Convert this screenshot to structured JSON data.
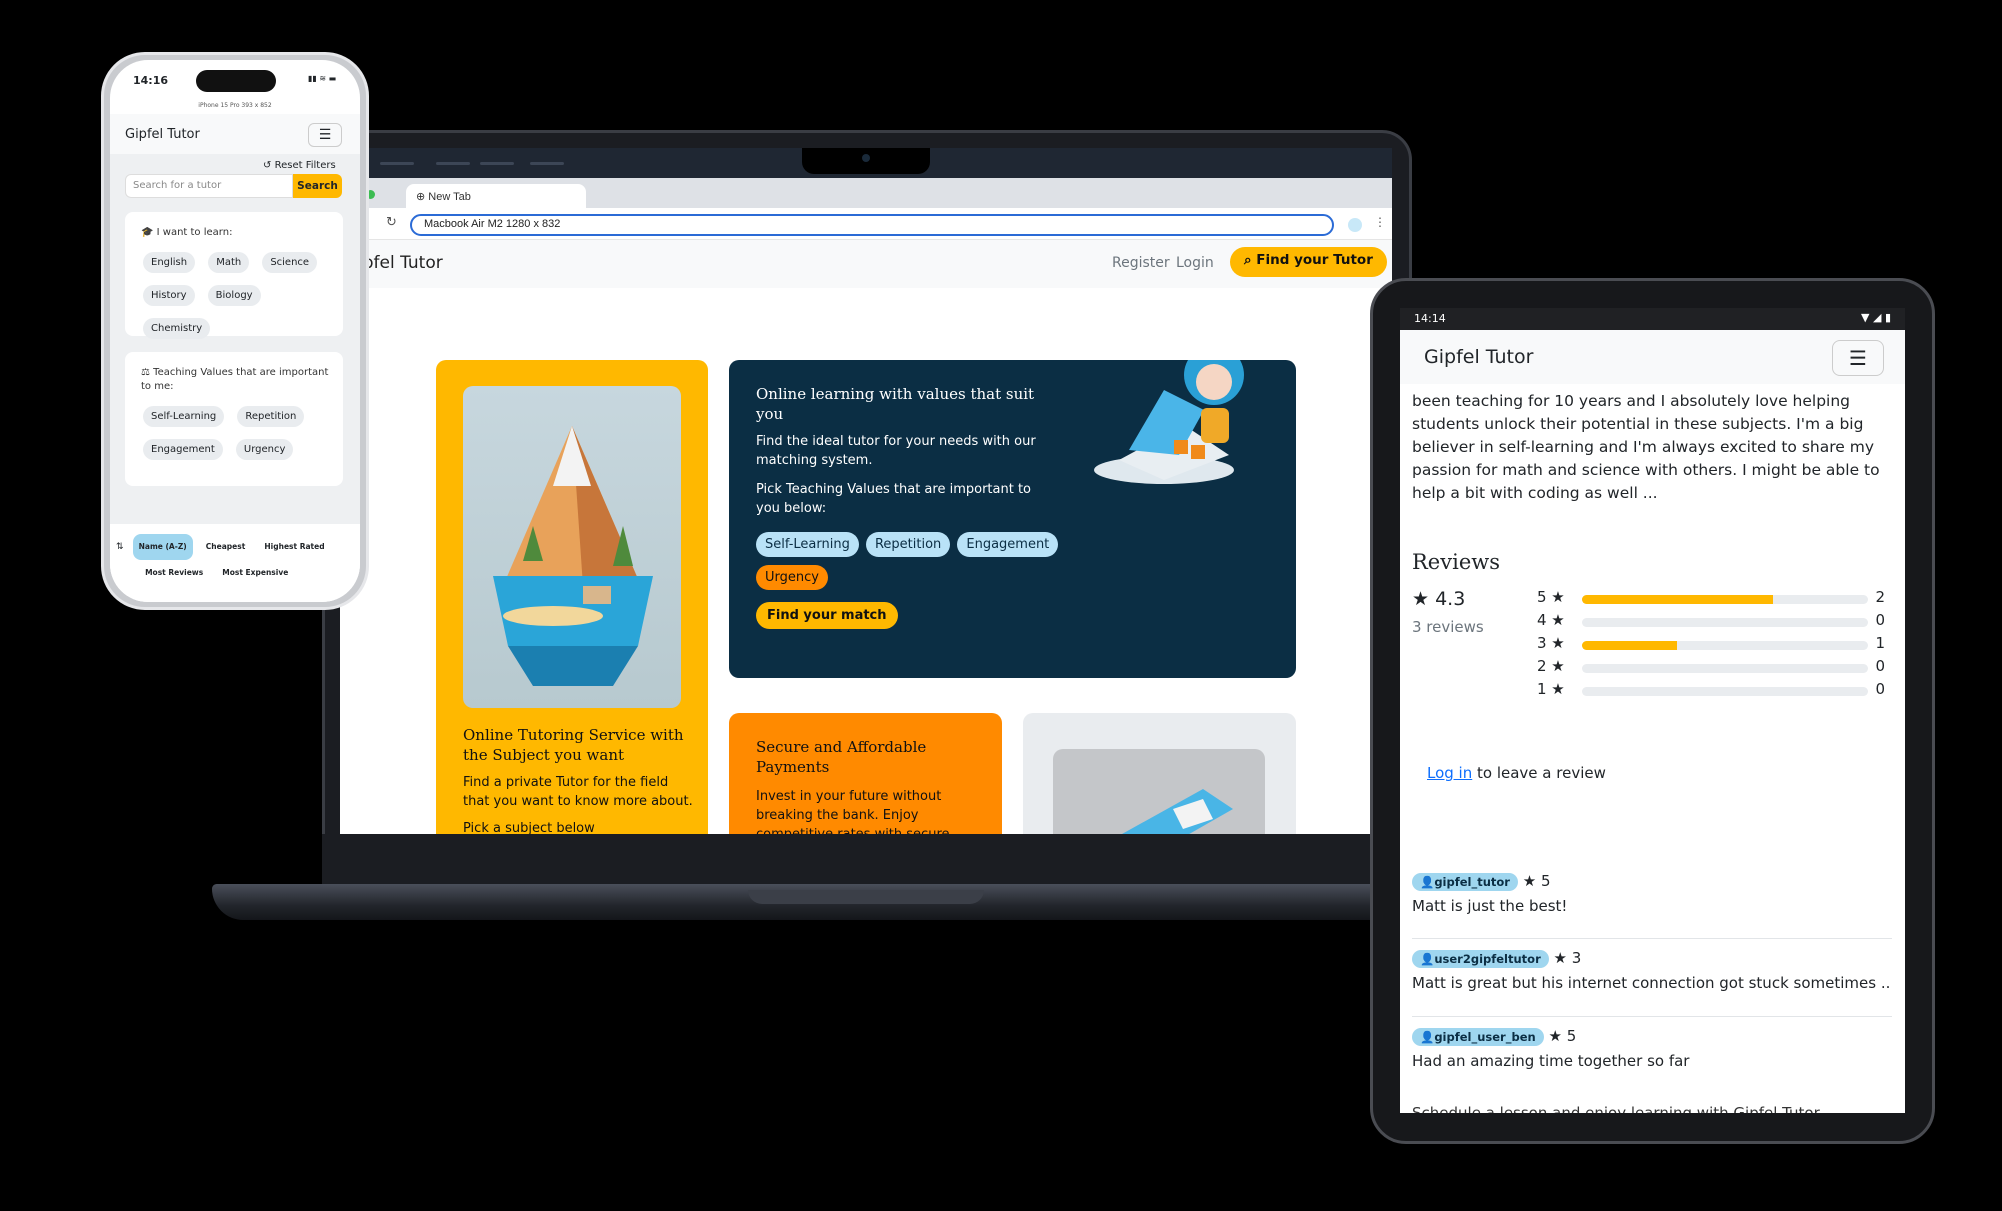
{
  "laptop": {
    "tab_title": "New Tab",
    "address": "Macbook Air M2  1280 x 832",
    "brand": "ipfel Tutor",
    "nav": {
      "register": "Register",
      "login": "Login",
      "find_tutor": "Find your Tutor"
    },
    "card_subject": {
      "title": "Online Tutoring Service with the Subject you want",
      "text": "Find a private Tutor for the field that you want to know more about.",
      "cut": "Pick a subject below"
    },
    "card_values": {
      "title": "Online learning with values that suit you",
      "text1": "Find the ideal tutor for your needs with our matching system.",
      "text2": "Pick Teaching Values that are important to you below:",
      "values": [
        "Self-Learning",
        "Repetition",
        "Engagement",
        "Urgency"
      ],
      "match_button": "Find your match"
    },
    "card_payments": {
      "title": "Secure and Affordable Payments",
      "text": "Invest in your future without breaking the bank. Enjoy competitive rates with secure"
    }
  },
  "phone": {
    "time": "14:16",
    "model": "iPhone 15 Pro  393 x 852",
    "brand": "Gipfel Tutor",
    "reset_filters": "Reset Filters",
    "search_placeholder": "Search for a tutor",
    "search_button": "Search",
    "learn_title": "I want to learn:",
    "subjects": [
      "English",
      "Math",
      "Science",
      "History",
      "Biology",
      "Chemistry"
    ],
    "values_title": "Teaching Values that are important to me:",
    "values": [
      "Self-Learning",
      "Repetition",
      "Engagement",
      "Urgency"
    ],
    "sort_options": [
      "Name (A-Z)",
      "Cheapest",
      "Highest Rated",
      "Most Reviews",
      "Most Expensive"
    ]
  },
  "tablet": {
    "time": "14:14",
    "brand": "Gipfel Tutor",
    "bio": "been teaching for 10 years and I absolutely love helping students unlock their potential in these subjects. I'm a big believer in self-learning and I'm always excited to share my passion for math and science with others. I might be able to help a bit with coding as well ...",
    "reviews_heading": "Reviews",
    "average": "4.3",
    "review_count": "3 reviews",
    "histogram": [
      {
        "stars": "5",
        "count": "2",
        "fraction": 0.667
      },
      {
        "stars": "4",
        "count": "0",
        "fraction": 0
      },
      {
        "stars": "3",
        "count": "1",
        "fraction": 0.333
      },
      {
        "stars": "2",
        "count": "0",
        "fraction": 0
      },
      {
        "stars": "1",
        "count": "0",
        "fraction": 0
      }
    ],
    "login_link": "Log in",
    "login_suffix": " to leave a review",
    "reviews": [
      {
        "user": "gipfel_tutor",
        "rating": "5",
        "text": "Matt is just the best!"
      },
      {
        "user": "user2gipfeltutor",
        "rating": "3",
        "text": "Matt is great but his internet connection got stuck sometimes .."
      },
      {
        "user": "gipfel_user_ben",
        "rating": "5",
        "text": "Had an amazing time together so far"
      }
    ],
    "cut_text": "Schedule a lesson and enjoy learning with Gipfel Tutor"
  },
  "colors": {
    "accent": "#ffb800",
    "dark": "#0b2e44",
    "orange": "#ff8a00",
    "light_pill": "#b9e2f7"
  },
  "icons": [
    "search-icon",
    "reset-icon",
    "graduation-cap-icon",
    "scale-icon",
    "sort-icon",
    "star-icon",
    "user-icon",
    "menu-icon",
    "globe-icon"
  ]
}
